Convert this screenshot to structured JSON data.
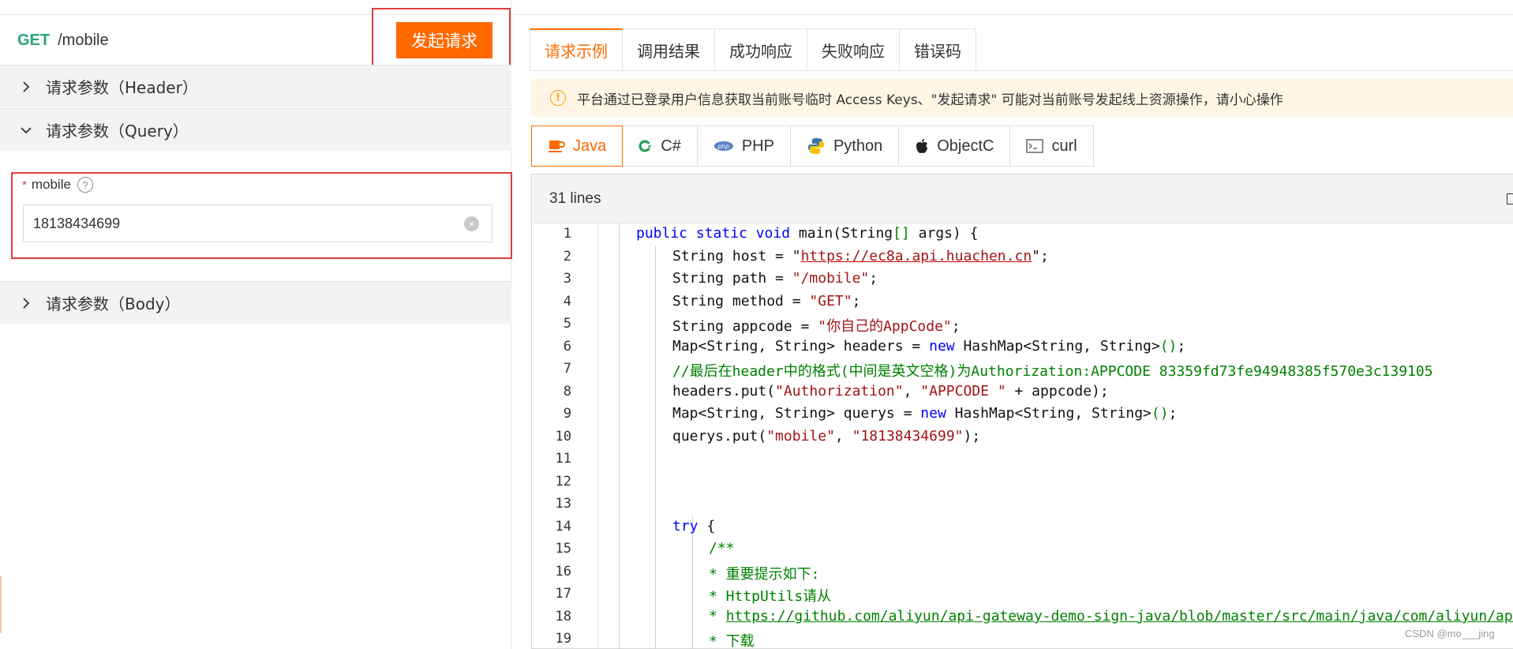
{
  "request": {
    "method": "GET",
    "path": "/mobile",
    "send_label": "发起请求"
  },
  "sections": {
    "header": "请求参数（Header）",
    "query": "请求参数（Query）",
    "body": "请求参数（Body）"
  },
  "param": {
    "required_mark": "*",
    "name": "mobile",
    "help_icon": "?",
    "value": "18138434699",
    "clear_icon": "×"
  },
  "tabs": [
    "请求示例",
    "调用结果",
    "成功响应",
    "失败响应",
    "错误码"
  ],
  "notice": {
    "icon": "!",
    "text": "平台通过已登录用户信息获取当前账号临时 Access Keys、\"发起请求\" 可能对当前账号发起线上资源操作，请小心操作"
  },
  "languages": [
    "Java",
    "C#",
    "PHP",
    "Python",
    "ObjectC",
    "curl"
  ],
  "code": {
    "line_count_label": "31 lines",
    "line_numbers": [
      "1",
      "2",
      "3",
      "4",
      "5",
      "6",
      "7",
      "8",
      "9",
      "10",
      "11",
      "12",
      "13",
      "14",
      "15",
      "16",
      "17",
      "18",
      "19"
    ],
    "l1": {
      "a": "public static void ",
      "b": "main(String",
      "c": "[]",
      "d": " args) {"
    },
    "l2": {
      "a": "String host = \"",
      "b": "https://ec8a.api.huachen.cn",
      "c": "\";"
    },
    "l3": {
      "a": "String path = ",
      "b": "\"/mobile\"",
      "c": ";"
    },
    "l4": {
      "a": "String method = ",
      "b": "\"GET\"",
      "c": ";"
    },
    "l5": {
      "a": "String appcode = ",
      "b": "\"你自己的AppCode\"",
      "c": ";"
    },
    "l6": {
      "a": "Map<String, String> headers = ",
      "b": "new",
      "c": " HashMap<String, String>",
      "d": "()",
      "e": ";"
    },
    "l7": "//最后在header中的格式(中间是英文空格)为Authorization:APPCODE 83359fd73fe94948385f570e3c139105",
    "l8": {
      "a": "headers.put(",
      "b": "\"Authorization\"",
      "c": ", ",
      "d": "\"APPCODE \"",
      "e": " + appcode);"
    },
    "l9": {
      "a": "Map<String, String> querys = ",
      "b": "new",
      "c": " HashMap<String, String>",
      "d": "()",
      "e": ";"
    },
    "l10": {
      "a": "querys.put(",
      "b": "\"mobile\"",
      "c": ", ",
      "d": "\"18138434699\"",
      "e": ");"
    },
    "l13": {
      "a": "try",
      "b": " {"
    },
    "l14": "/**",
    "l15": "* 重要提示如下:",
    "l16": "* HttpUtils请从",
    "l17": {
      "a": "* ",
      "b": "https://github.com/aliyun/api-gateway-demo-sign-java/blob/master/src/main/java/com/aliyun/api/gateway/demo/util/HttpUtils.java"
    },
    "l18": "* 下载",
    "l19": "*"
  },
  "watermark": "CSDN @mo___jing",
  "colors": {
    "accent": "#ff6a00",
    "get": "#2aa57a",
    "highlight_border": "#e23b3b",
    "keyword": "#0000ff",
    "string": "#a31515",
    "comment": "#008000"
  }
}
